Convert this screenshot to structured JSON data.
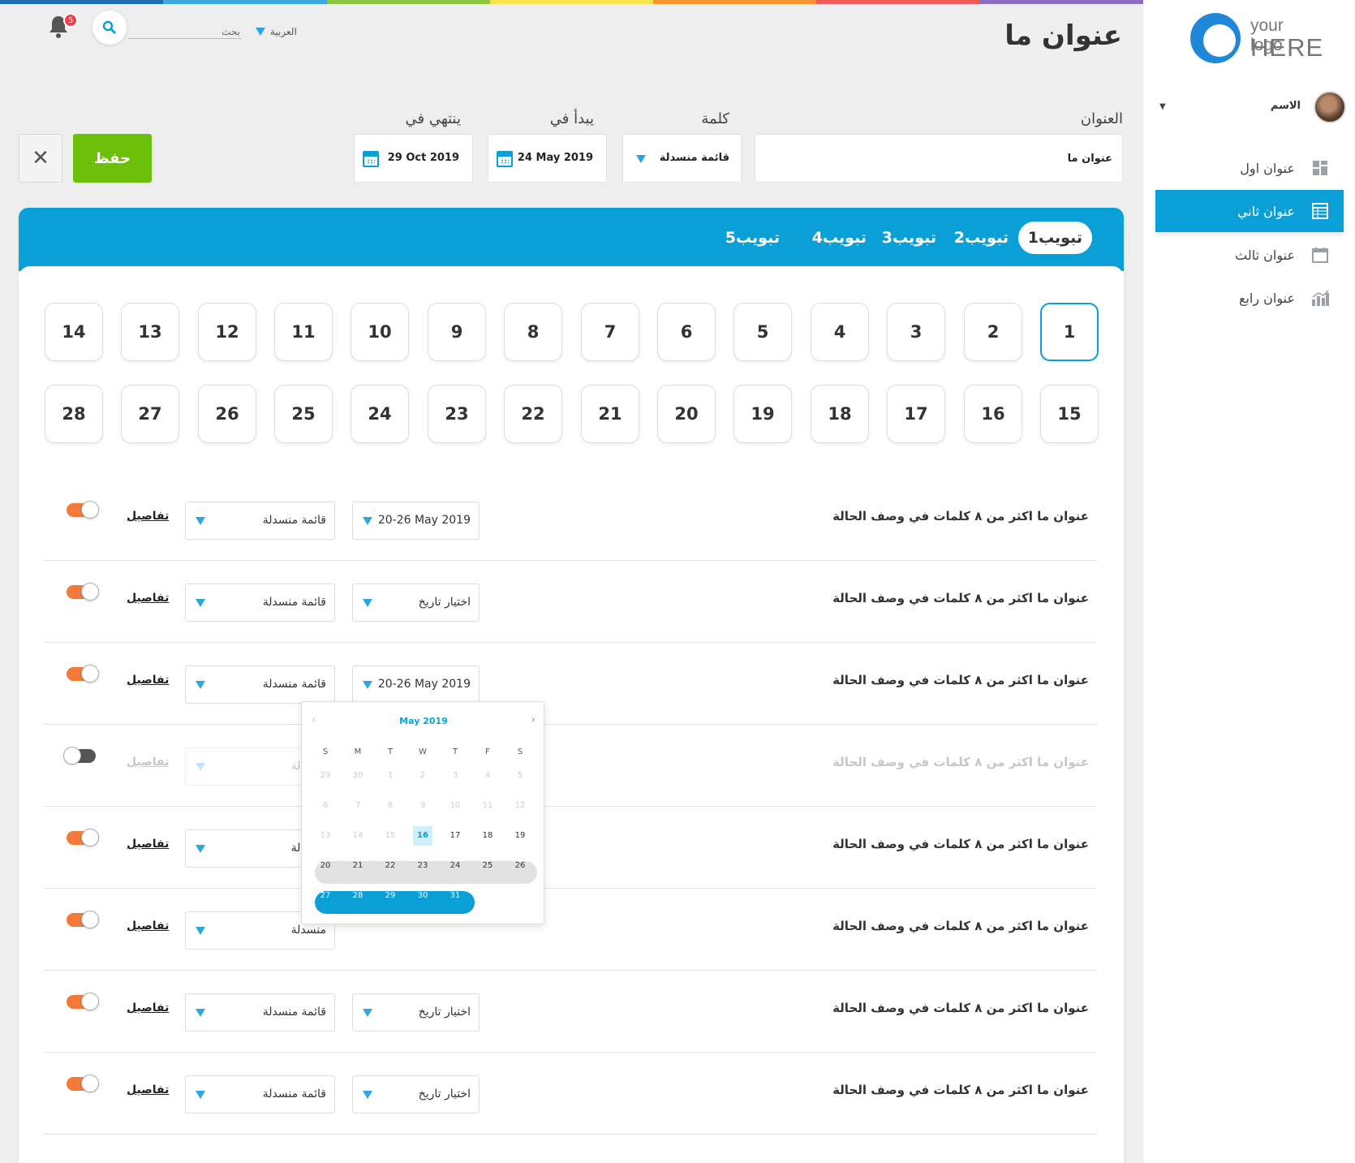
{
  "rainbow_colors": [
    "#1f6fb8",
    "#3ca9e3",
    "#8cc63f",
    "#f5e44c",
    "#f7962e",
    "#ee5a5a",
    "#8e6bbf"
  ],
  "sidebar": {
    "logo_line1": "your logo",
    "logo_line2": "HERE",
    "user_name": "الاسم",
    "items": [
      {
        "label": "عنوان اول",
        "icon": "dashboard-icon",
        "active": false
      },
      {
        "label": "عنوان ثاني",
        "icon": "table-icon",
        "active": true
      },
      {
        "label": "عنوان ثالث",
        "icon": "calendar-icon",
        "active": false
      },
      {
        "label": "عنوان رابع",
        "icon": "chart-icon",
        "active": false
      }
    ]
  },
  "header": {
    "title": "عنوان ما",
    "notification_count": "5",
    "search_placeholder": "بحث",
    "language": "العربية"
  },
  "form": {
    "title_label": "العنوان",
    "title_value": "عنوان ما",
    "word_label": "كلمة",
    "word_value": "قائمة منسدلة",
    "start_label": "يبدأ في",
    "start_value": "24 May 2019",
    "end_label": "ينتهي في",
    "end_value": "29 Oct 2019",
    "save_label": "حفظ",
    "close_label": "✕"
  },
  "tabs": [
    "تبويب1",
    "تبويب2",
    "تبويب3",
    "تبويب4",
    "تبويب5"
  ],
  "active_tab": 0,
  "days_row1": [
    "1",
    "2",
    "3",
    "4",
    "5",
    "6",
    "7",
    "8",
    "9",
    "10",
    "11",
    "12",
    "13",
    "14"
  ],
  "days_row2": [
    "15",
    "16",
    "17",
    "18",
    "19",
    "20",
    "21",
    "22",
    "23",
    "24",
    "25",
    "26",
    "27",
    "28"
  ],
  "active_day": "1",
  "rows": [
    {
      "title": "عنوان ما اكثر من ٨ كلمات في وصف الحالة",
      "date": "20-26 May 2019",
      "dropdown": "قائمة منسدلة",
      "details": "تفاصيل",
      "enabled": true
    },
    {
      "title": "عنوان ما اكثر من ٨ كلمات في وصف الحالة",
      "date": "اختيار تاريخ",
      "dropdown": "قائمة منسدلة",
      "details": "تفاصيل",
      "enabled": true
    },
    {
      "title": "عنوان ما اكثر من ٨ كلمات في وصف الحالة",
      "date": "20-26 May 2019",
      "dropdown": "قائمة منسدلة",
      "details": "تفاصيل",
      "enabled": true
    },
    {
      "title": "عنوان ما اكثر من ٨ كلمات في وصف الحالة",
      "date": "",
      "dropdown": "منسدلة",
      "details": "تفاصيل",
      "enabled": false
    },
    {
      "title": "عنوان ما اكثر من ٨ كلمات في وصف الحالة",
      "date": "",
      "dropdown": "منسدلة",
      "details": "تفاصيل",
      "enabled": true
    },
    {
      "title": "عنوان ما اكثر من ٨ كلمات في وصف الحالة",
      "date": "",
      "dropdown": "منسدلة",
      "details": "تفاصيل",
      "enabled": true
    },
    {
      "title": "عنوان ما اكثر من ٨ كلمات في وصف الحالة",
      "date": "اختيار تاريخ",
      "dropdown": "قائمة منسدلة",
      "details": "تفاصيل",
      "enabled": true
    },
    {
      "title": "عنوان ما اكثر من ٨ كلمات في وصف الحالة",
      "date": "اختيار تاريخ",
      "dropdown": "قائمة منسدلة",
      "details": "تفاصيل",
      "enabled": true
    }
  ],
  "datepicker": {
    "month": "May 2019",
    "weekdays": [
      "S",
      "M",
      "T",
      "W",
      "T",
      "F",
      "S"
    ],
    "weeks": [
      [
        "29",
        "30",
        "1",
        "2",
        "3",
        "4",
        "5"
      ],
      [
        "6",
        "7",
        "8",
        "9",
        "10",
        "11",
        "12"
      ],
      [
        "13",
        "14",
        "15",
        "16",
        "17",
        "18",
        "19"
      ],
      [
        "20",
        "21",
        "22",
        "23",
        "24",
        "25",
        "26"
      ],
      [
        "27",
        "28",
        "29",
        "30",
        "31"
      ]
    ],
    "today": "16",
    "accent": "#0b9fd8"
  }
}
